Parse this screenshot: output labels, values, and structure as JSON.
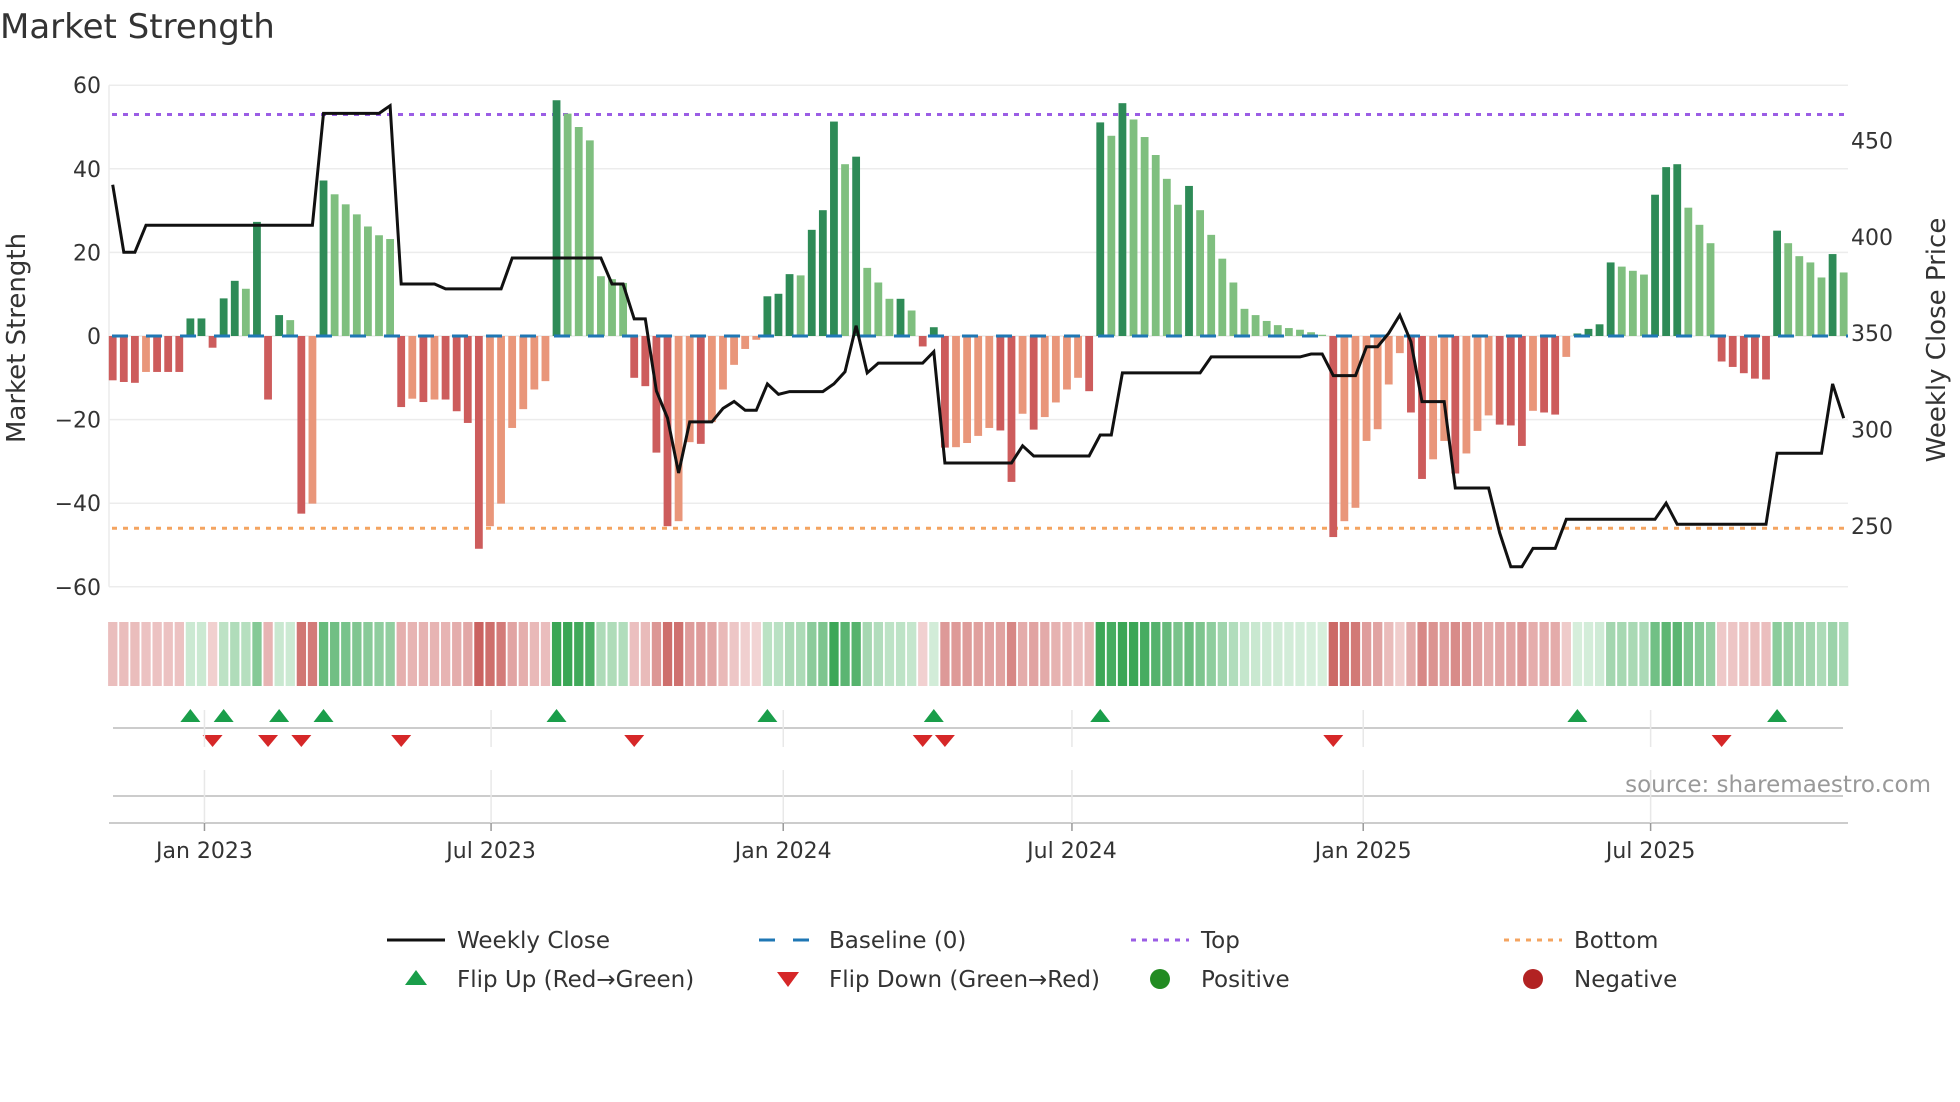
{
  "chart_data": {
    "type": "bar",
    "title": "Market Strength",
    "ylabel": "Market Strength",
    "y2label": "Weekly Close Price",
    "ylim": [
      -60,
      60
    ],
    "y2lim": [
      221,
      483
    ],
    "y_ticks": [
      60,
      40,
      20,
      0,
      -20,
      -40,
      -60
    ],
    "y_tick_labels": [
      "60",
      "40",
      "20",
      "0",
      "−20",
      "−40",
      "−60"
    ],
    "y2_ticks": [
      450,
      400,
      350,
      300,
      250
    ],
    "y2_tick_labels": [
      "450",
      "400",
      "350",
      "300",
      "250"
    ],
    "x_ticks": [
      {
        "label": "Jan 2023",
        "week": 8.27
      },
      {
        "label": "Jul 2023",
        "week": 34.1
      },
      {
        "label": "Jan 2024",
        "week": 60.43
      },
      {
        "label": "Jul 2024",
        "week": 86.45
      },
      {
        "label": "Jan 2025",
        "week": 112.7
      },
      {
        "label": "Jul 2025",
        "week": 138.6
      }
    ],
    "x_unit": "week index",
    "top_level": 53,
    "bottom_level": -46,
    "baseline": 0,
    "grid": true,
    "strength": [
      -10.6,
      -11,
      -11.2,
      -8.6,
      -8.6,
      -8.6,
      -8.6,
      4.2,
      4.2,
      -2.8,
      9.0,
      13.2,
      11.3,
      27.3,
      -15.2,
      5.0,
      3.8,
      -42.5,
      -40.1,
      37.2,
      33.9,
      31.5,
      29.1,
      26.2,
      24.1,
      23.2,
      -17.0,
      -15,
      -15.8,
      -15.2,
      -15.2,
      -18,
      -20.8,
      -50.9,
      -45.5,
      -40.1,
      -22,
      -17.5,
      -12.8,
      -10.8,
      56.4,
      53.2,
      50,
      46.8,
      14.3,
      13.6,
      12.7,
      -10,
      -12,
      -27.9,
      -45.5,
      -44.3,
      -25.4,
      -25.8,
      -20.6,
      -12.8,
      -6.9,
      -3.1,
      -0.9,
      9.5,
      10.1,
      14.8,
      14.5,
      25.4,
      30.1,
      51.3,
      41.1,
      42.9,
      16.3,
      12.8,
      8.9,
      8.9,
      6.1,
      -2.5,
      2.1,
      -26.7,
      -26.6,
      -25.6,
      -23.9,
      -22,
      -22.6,
      -34.9,
      -18.6,
      -22.4,
      -19.4,
      -15.9,
      -12.8,
      -10,
      -13.2,
      51.1,
      47.9,
      55.7,
      51.8,
      47.6,
      43.3,
      37.6,
      31.4,
      35.9,
      30.1,
      24.2,
      18.5,
      12.8,
      6.5,
      5.0,
      3.6,
      2.6,
      1.9,
      1.5,
      0.9,
      0.3,
      -48.1,
      -44.3,
      -41.1,
      -25.1,
      -22.3,
      -11.6,
      -4.1,
      -18.3,
      -34.2,
      -29.5,
      -25.1,
      -32.9,
      -28.1,
      -22.7,
      -19,
      -21.2,
      -21.4,
      -26.3,
      -17.9,
      -18.3,
      -18.8,
      -5.0,
      0.6,
      1.7,
      2.8,
      17.6,
      16.6,
      15.6,
      14.7,
      33.8,
      40.4,
      41.1,
      30.7,
      26.6,
      22.2,
      -6.1,
      -7.4,
      -8.9,
      -10.2,
      -10.4,
      25.2,
      22.2,
      19.1,
      17.6,
      14,
      19.6,
      15.2
    ],
    "strength_shade": [
      "D",
      "D",
      "D",
      "L",
      "D",
      "D",
      "D",
      "D",
      "D",
      "D",
      "D",
      "D",
      "L",
      "D",
      "D",
      "D",
      "L",
      "D",
      "L",
      "D",
      "L",
      "L",
      "L",
      "L",
      "L",
      "L",
      "D",
      "L",
      "D",
      "L",
      "D",
      "D",
      "D",
      "D",
      "L",
      "L",
      "L",
      "L",
      "L",
      "L",
      "D",
      "L",
      "L",
      "L",
      "L",
      "L",
      "L",
      "D",
      "D",
      "D",
      "D",
      "L",
      "L",
      "D",
      "L",
      "L",
      "L",
      "L",
      "L",
      "D",
      "D",
      "D",
      "L",
      "D",
      "D",
      "D",
      "L",
      "D",
      "L",
      "L",
      "L",
      "D",
      "L",
      "D",
      "D",
      "D",
      "L",
      "L",
      "L",
      "L",
      "D",
      "D",
      "L",
      "D",
      "L",
      "L",
      "L",
      "L",
      "D",
      "D",
      "L",
      "D",
      "L",
      "L",
      "L",
      "L",
      "L",
      "D",
      "L",
      "L",
      "L",
      "L",
      "L",
      "L",
      "L",
      "L",
      "L",
      "L",
      "L",
      "L",
      "D",
      "L",
      "L",
      "L",
      "L",
      "L",
      "L",
      "D",
      "D",
      "L",
      "L",
      "D",
      "L",
      "L",
      "L",
      "D",
      "D",
      "D",
      "L",
      "D",
      "D",
      "L",
      "D",
      "D",
      "D",
      "D",
      "L",
      "L",
      "L",
      "D",
      "D",
      "D",
      "L",
      "L",
      "L",
      "D",
      "D",
      "D",
      "D",
      "D",
      "D",
      "L",
      "L",
      "L",
      "L",
      "D",
      "L"
    ],
    "weekly_close": [
      427,
      392,
      392,
      406,
      406,
      406,
      406,
      406,
      406,
      406,
      406,
      406,
      406,
      406,
      406,
      406,
      406,
      406,
      406,
      464,
      464,
      464,
      464,
      464,
      464,
      468,
      375.5,
      375.5,
      375.5,
      375.5,
      373,
      373,
      373,
      373,
      373,
      373,
      389,
      389,
      389,
      389,
      389,
      389,
      389,
      389,
      389,
      375.5,
      375.5,
      357.4,
      357.4,
      320,
      306,
      277.5,
      304,
      304,
      304,
      311,
      314.6,
      310,
      310,
      323.7,
      318.3,
      319.7,
      319.7,
      319.7,
      319.7,
      323.7,
      330,
      353.9,
      329.4,
      334.5,
      334.5,
      334.5,
      334.5,
      334.5,
      340.4,
      282.7,
      282.7,
      282.7,
      282.7,
      282.7,
      282.7,
      282.7,
      291.6,
      286.3,
      286.3,
      286.3,
      286.3,
      286.3,
      286.3,
      297.2,
      297.2,
      329.4,
      329.4,
      329.4,
      329.4,
      329.4,
      329.4,
      329.4,
      329.4,
      337.7,
      337.7,
      337.7,
      337.7,
      337.7,
      337.7,
      337.7,
      337.7,
      337.7,
      339.2,
      339.2,
      328,
      328,
      328,
      343,
      343,
      350,
      359.4,
      345.6,
      314.5,
      314.5,
      314.5,
      269.7,
      269.7,
      269.7,
      269.7,
      246.4,
      228.9,
      228.9,
      238.4,
      238.4,
      238.4,
      253.5,
      253.5,
      253.5,
      253.5,
      253.5,
      253.5,
      253.5,
      253.5,
      253.5,
      261.8,
      250.9,
      250.9,
      250.9,
      250.9,
      250.9,
      250.9,
      250.9,
      250.9,
      250.9,
      287.7,
      287.7,
      287.7,
      287.7,
      287.7,
      323.7,
      305.9
    ],
    "flip_up_weeks": [
      7,
      10,
      15,
      19,
      40,
      59,
      74,
      89,
      132,
      150
    ],
    "flip_down_weeks": [
      9,
      14,
      17,
      26,
      47,
      73,
      75,
      110,
      145
    ],
    "legend": {
      "placement": "bottom",
      "items": [
        {
          "label": "Weekly Close",
          "kind": "line"
        },
        {
          "label": "Baseline (0)",
          "kind": "dash"
        },
        {
          "label": "Top",
          "kind": "dot-top"
        },
        {
          "label": "Bottom",
          "kind": "dot-bottom"
        },
        {
          "label": "Flip Up (Red→Green)",
          "kind": "tri-up"
        },
        {
          "label": "Flip Down (Green→Red)",
          "kind": "tri-down"
        },
        {
          "label": "Positive",
          "kind": "circle-pos"
        },
        {
          "label": "Negative",
          "kind": "circle-neg"
        }
      ]
    },
    "annotation": "source: sharemaestro.com"
  },
  "colors": {
    "green_dark": "#2e8b57",
    "green_light": "#7fbf7f",
    "red_dark": "#cd5c5c",
    "red_light": "#e9967a",
    "price_line": "#111111",
    "baseline": "#1f77b4",
    "top": "#9b5de5",
    "bottom": "#f4a460",
    "flip_up": "#1a9e4a",
    "flip_down": "#d62728",
    "positive": "#228b22",
    "negative": "#b22222",
    "grid": "#ececec"
  }
}
